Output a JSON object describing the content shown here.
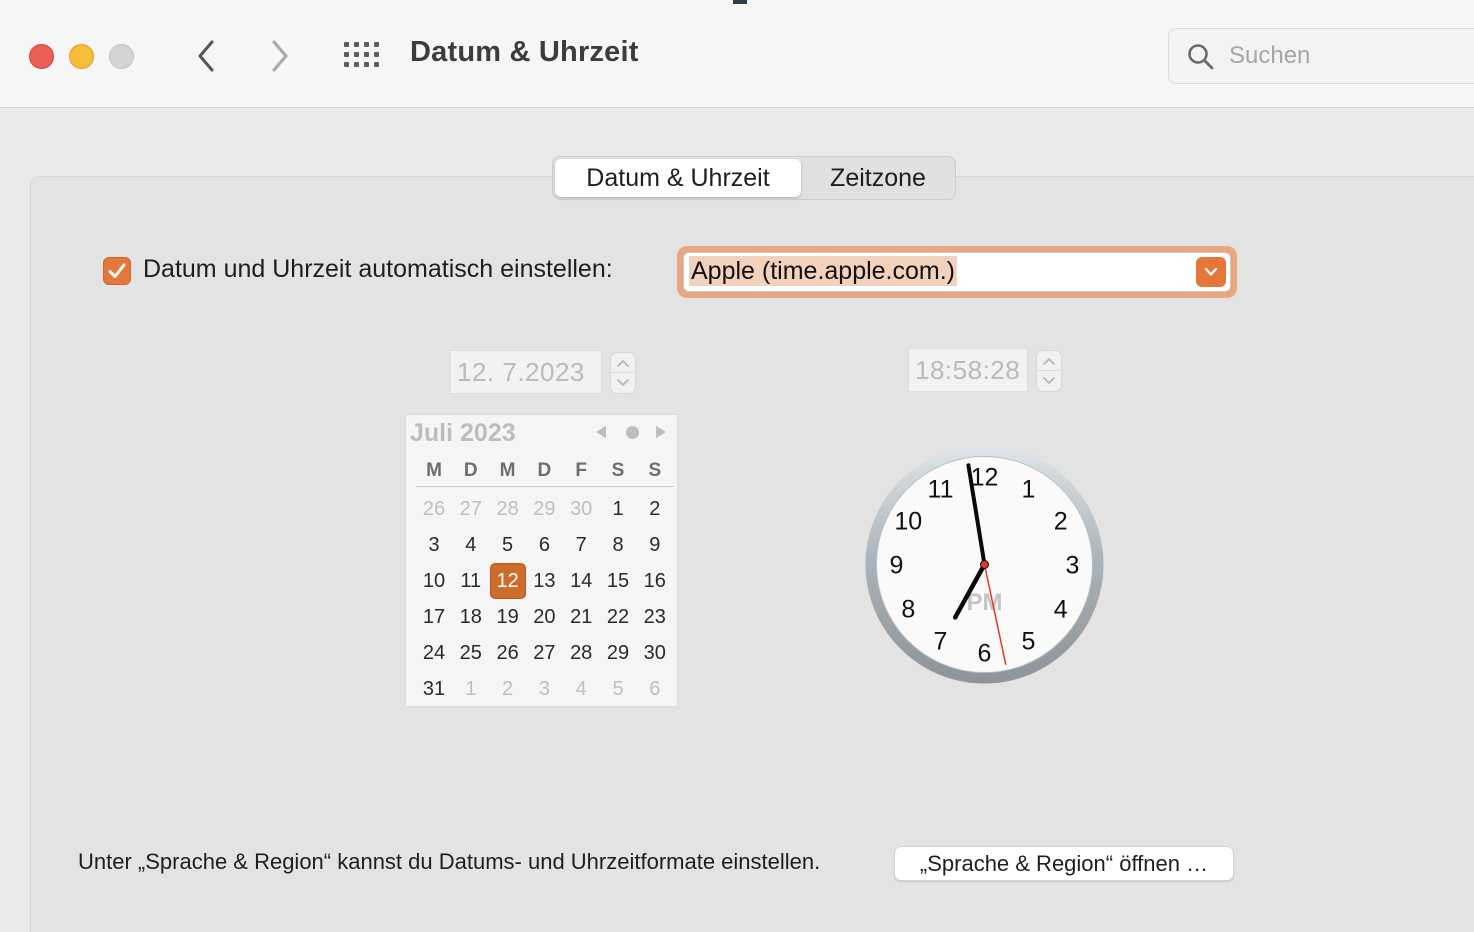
{
  "window": {
    "title": "Datum & Uhrzeit"
  },
  "search": {
    "placeholder": "Suchen"
  },
  "tabs": [
    {
      "label": "Datum & Uhrzeit",
      "selected": true
    },
    {
      "label": "Zeitzone",
      "selected": false
    }
  ],
  "auto_set": {
    "checked": true,
    "label": "Datum und Uhrzeit automatisch einstellen:",
    "server": "Apple (time.apple.com.)"
  },
  "date_field": {
    "value": "12.  7.2023"
  },
  "time_field": {
    "value": "18:58:28"
  },
  "calendar": {
    "month_title": "Juli 2023",
    "weekdays": [
      "M",
      "D",
      "M",
      "D",
      "F",
      "S",
      "S"
    ],
    "weeks": [
      [
        "26",
        "27",
        "28",
        "29",
        "30",
        "1",
        "2"
      ],
      [
        "3",
        "4",
        "5",
        "6",
        "7",
        "8",
        "9"
      ],
      [
        "10",
        "11",
        "12",
        "13",
        "14",
        "15",
        "16"
      ],
      [
        "17",
        "18",
        "19",
        "20",
        "21",
        "22",
        "23"
      ],
      [
        "24",
        "25",
        "26",
        "27",
        "28",
        "29",
        "30"
      ],
      [
        "31",
        "1",
        "2",
        "3",
        "4",
        "5",
        "6"
      ]
    ],
    "selected_day": "12"
  },
  "clock": {
    "numbers": [
      "12",
      "1",
      "2",
      "3",
      "4",
      "5",
      "6",
      "7",
      "8",
      "9",
      "10",
      "11"
    ],
    "period": "PM",
    "hour": 18,
    "minute": 58,
    "second": 28
  },
  "footer": {
    "text": "Unter „Sprache & Region“ kannst du Datums- und Uhrzeitformate einstellen.",
    "button_label": "„Sprache & Region“ öffnen …"
  },
  "colors": {
    "accent": "#e5773a",
    "selected_day": "#cd6d2d",
    "second_hand": "#e0382c"
  }
}
